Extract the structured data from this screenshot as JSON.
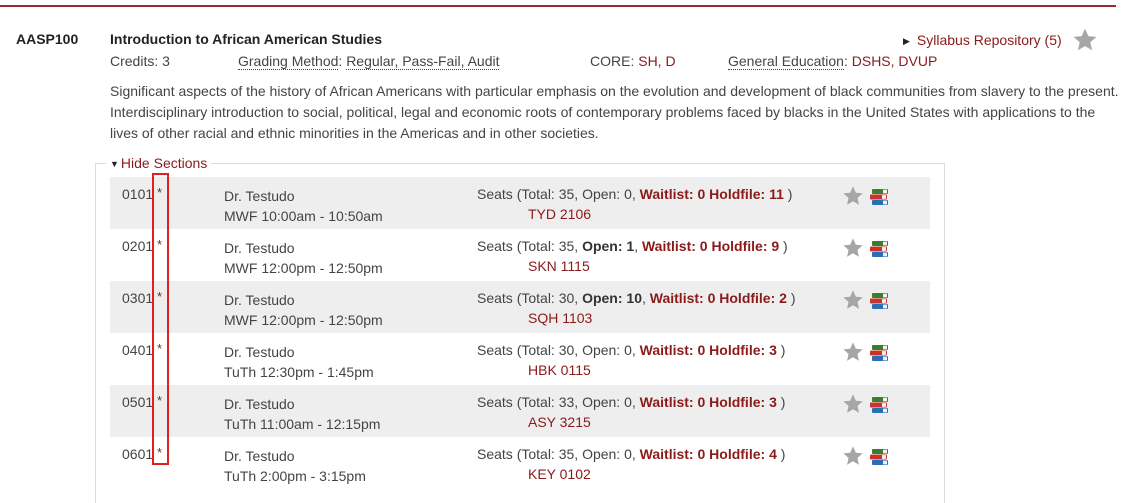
{
  "course": {
    "id": "AASP100",
    "title": "Introduction to African American Studies",
    "credits_label": "Credits:",
    "credits_value": "3",
    "grading_label": "Grading Method",
    "grading_value": "Regular, Pass-Fail, Audit",
    "core_label": "CORE:",
    "core_value": "SH, D",
    "gened_label": "General Education",
    "gened_value": "DSHS, DVUP",
    "syllabus_link": "Syllabus Repository (5)",
    "description": "Significant aspects of the history of African Americans with particular emphasis on the evolution and development of black communities from slavery to the present. Interdisciplinary introduction to social, political, legal and economic roots of contemporary problems faced by blacks in the United States with applications to the lives of other racial and ethnic minorities in the Americas and in other societies."
  },
  "sections_toggle": "Hide Sections",
  "seats_prefix": "Seats (Total: ",
  "colors": {
    "accent": "#8b1a1a",
    "highlight": "#e02020",
    "row_alt": "#eeeeee"
  },
  "sections": [
    {
      "num": "0101",
      "flag": "*",
      "instructor": "Dr. Testudo",
      "schedule": "MWF 10:00am - 10:50am",
      "total": "35",
      "open": "0",
      "open_bold": false,
      "waitlist": "0",
      "holdfile": "11",
      "room": "TYD 2106"
    },
    {
      "num": "0201",
      "flag": "*",
      "instructor": "Dr. Testudo",
      "schedule": "MWF 12:00pm - 12:50pm",
      "total": "35",
      "open": "1",
      "open_bold": true,
      "waitlist": "0",
      "holdfile": "9",
      "room": "SKN 1115"
    },
    {
      "num": "0301",
      "flag": "*",
      "instructor": "Dr. Testudo",
      "schedule": "MWF 12:00pm - 12:50pm",
      "total": "30",
      "open": "10",
      "open_bold": true,
      "waitlist": "0",
      "holdfile": "2",
      "room": "SQH 1103"
    },
    {
      "num": "0401",
      "flag": "*",
      "instructor": "Dr. Testudo",
      "schedule": "TuTh 12:30pm - 1:45pm",
      "total": "30",
      "open": "0",
      "open_bold": false,
      "waitlist": "0",
      "holdfile": "3",
      "room": "HBK 0115"
    },
    {
      "num": "0501",
      "flag": "*",
      "instructor": "Dr. Testudo",
      "schedule": "TuTh 11:00am - 12:15pm",
      "total": "33",
      "open": "0",
      "open_bold": false,
      "waitlist": "0",
      "holdfile": "3",
      "room": "ASY 3215"
    },
    {
      "num": "0601",
      "flag": "*",
      "instructor": "Dr. Testudo",
      "schedule": "TuTh 2:00pm - 3:15pm",
      "total": "35",
      "open": "0",
      "open_bold": false,
      "waitlist": "0",
      "holdfile": "4",
      "room": "KEY 0102"
    }
  ]
}
